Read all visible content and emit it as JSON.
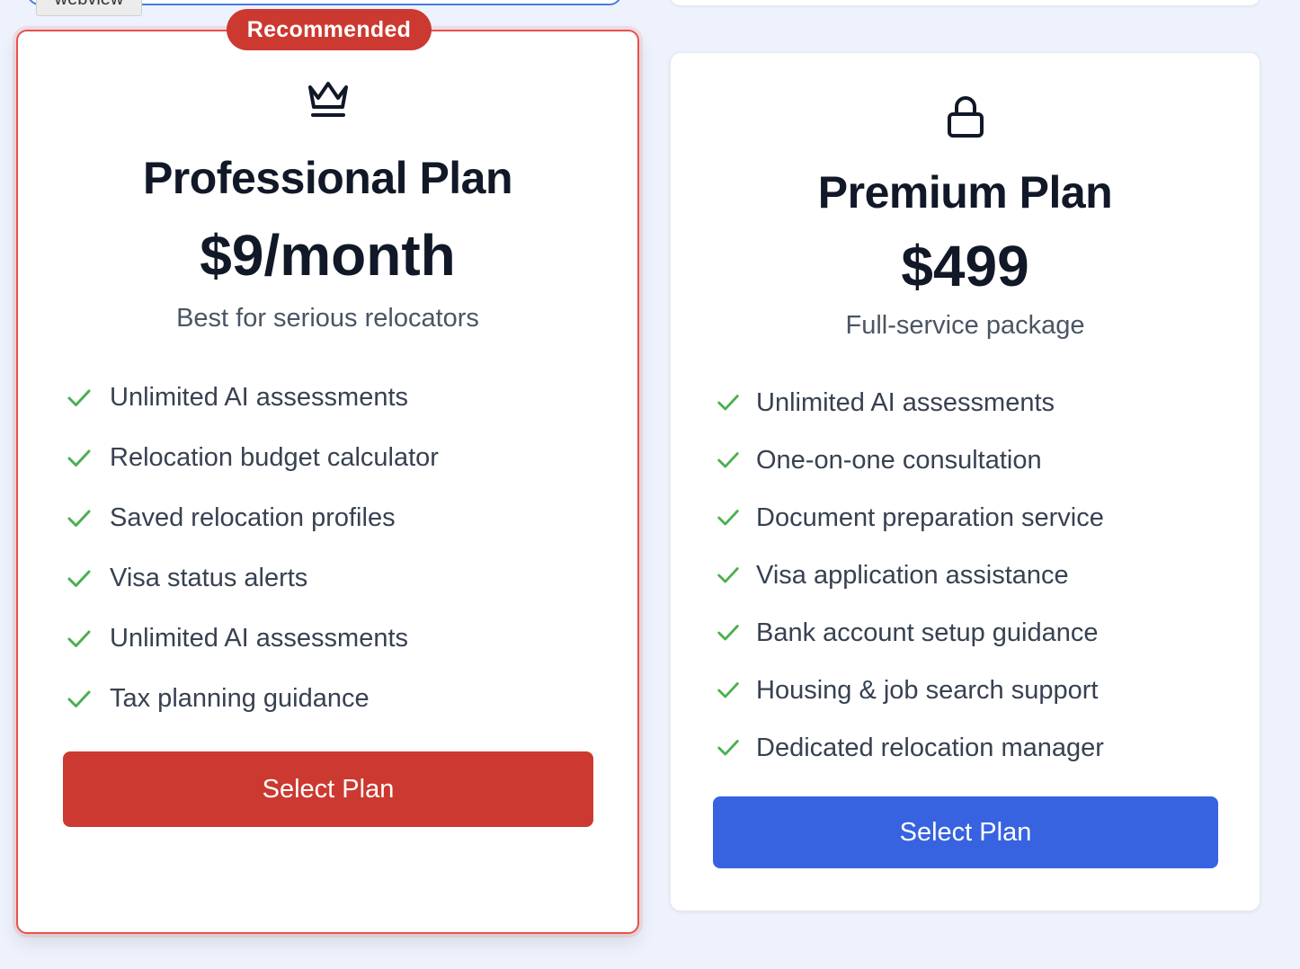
{
  "webview_tag": "webview",
  "plans": [
    {
      "id": "professional",
      "badge": "Recommended",
      "icon": "crown-icon",
      "title": "Professional Plan",
      "price": "$9/month",
      "description": "Best for serious relocators",
      "features": [
        "Unlimited AI assessments",
        "Relocation budget calculator",
        "Saved relocation profiles",
        "Visa status alerts",
        "Unlimited AI assessments",
        "Tax planning guidance"
      ],
      "button_label": "Select Plan",
      "accent_color": "#cc3930"
    },
    {
      "id": "premium",
      "icon": "lock-icon",
      "title": "Premium Plan",
      "price": "$499",
      "description": "Full-service package",
      "features": [
        "Unlimited AI assessments",
        "One-on-one consultation",
        "Document preparation service",
        "Visa application assistance",
        "Bank account setup guidance",
        "Housing & job search support",
        "Dedicated relocation manager"
      ],
      "button_label": "Select Plan",
      "accent_color": "#3763e0"
    }
  ],
  "colors": {
    "background": "#eef2fc",
    "check": "#4caf50",
    "recommended_border": "#e8524a"
  }
}
